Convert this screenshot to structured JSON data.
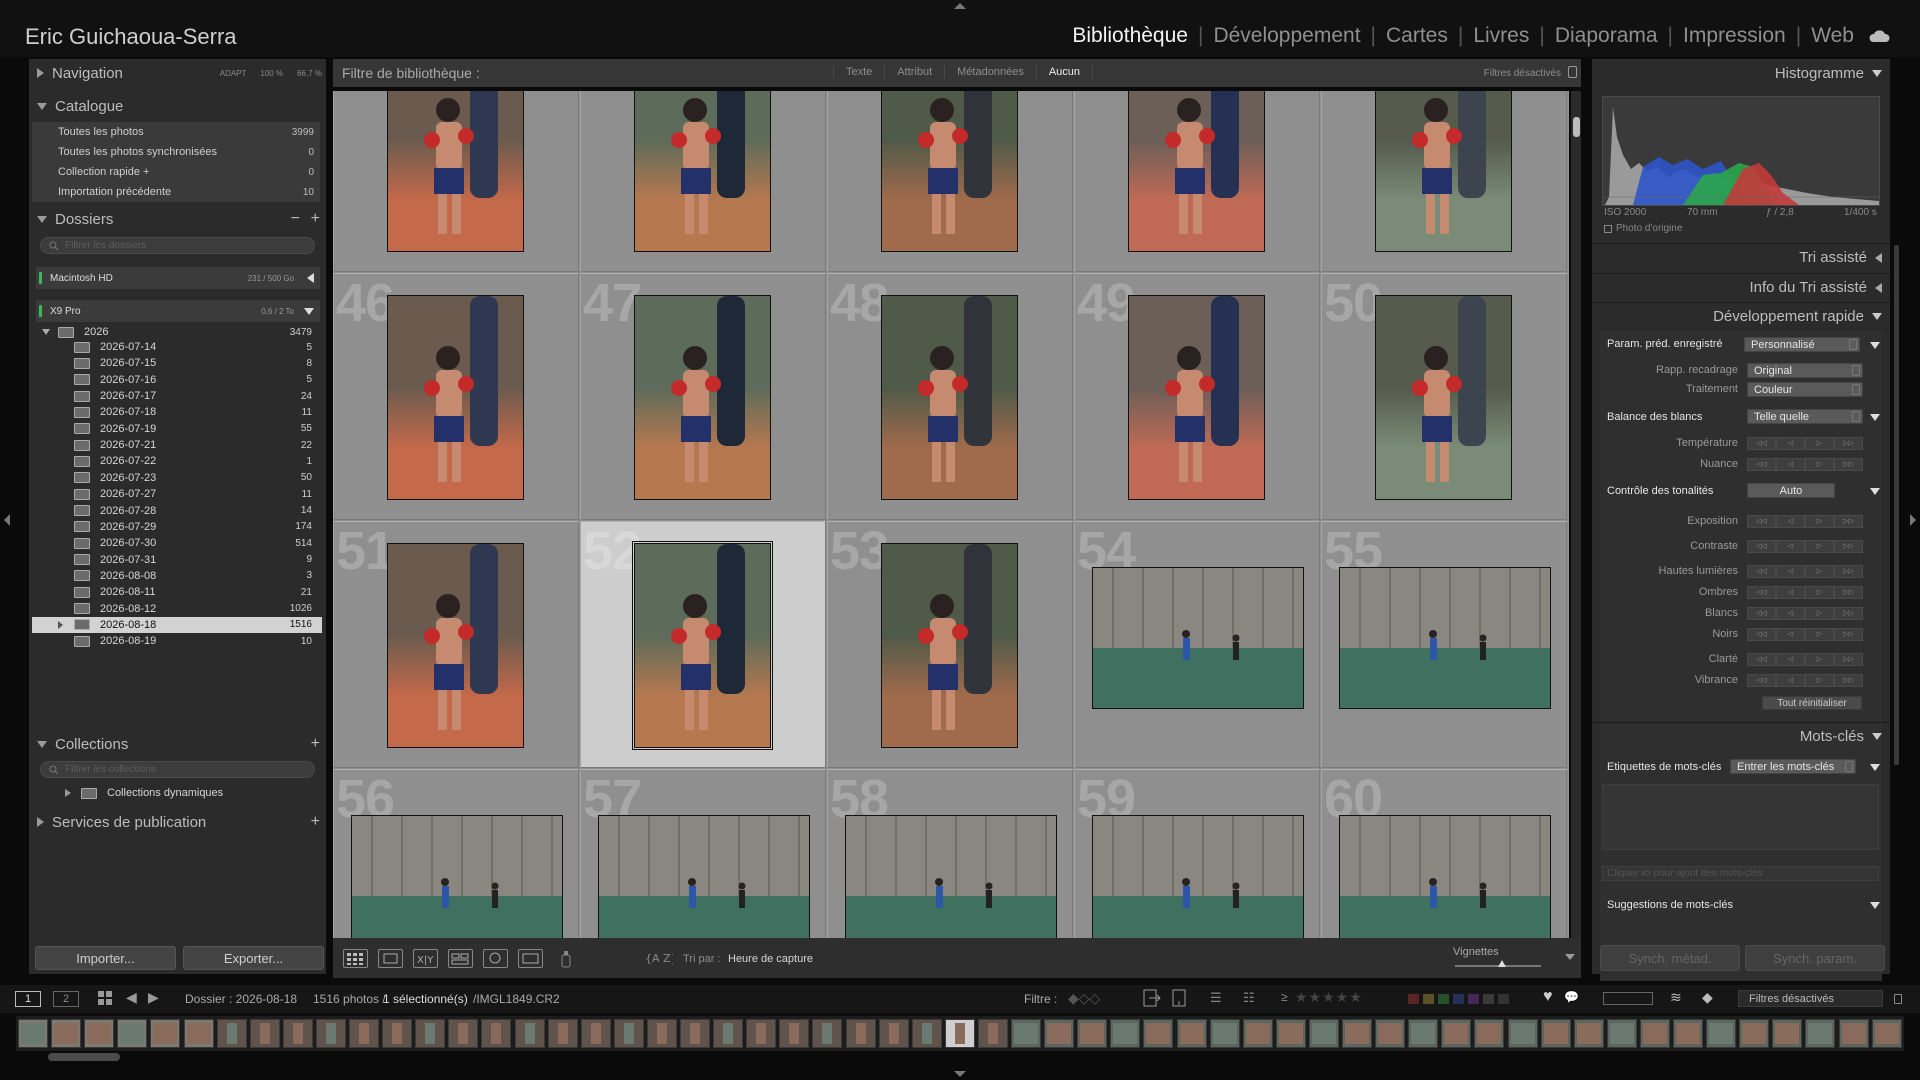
{
  "app": {
    "identity": "Eric Guichaoua-Serra",
    "modules": [
      "Bibliothèque",
      "Développement",
      "Cartes",
      "Livres",
      "Diaporama",
      "Impression",
      "Web"
    ],
    "active_module": "Bibliothèque"
  },
  "left_panel": {
    "navigation": {
      "title": "Navigation",
      "opts": [
        "ADAPT",
        "100 %",
        "66,7 %"
      ]
    },
    "catalogue": {
      "title": "Catalogue",
      "items": [
        {
          "label": "Toutes les photos",
          "count": "3999"
        },
        {
          "label": "Toutes les photos synchronisées",
          "count": "0"
        },
        {
          "label": "Collection rapide +",
          "count": "0"
        },
        {
          "label": "Importation précédente",
          "count": "10"
        }
      ]
    },
    "dossiers": {
      "title": "Dossiers",
      "search_placeholder": "Filtrer les dossiers",
      "volumes": [
        {
          "name": "Macintosh HD",
          "size": "231 / 500 Go"
        },
        {
          "name": "X9 Pro",
          "size": "0,6 / 2 To"
        }
      ],
      "root": {
        "name": "2026",
        "count": "3479"
      },
      "folders": [
        {
          "name": "2026-07-14",
          "count": "5"
        },
        {
          "name": "2026-07-15",
          "count": "8"
        },
        {
          "name": "2026-07-16",
          "count": "5"
        },
        {
          "name": "2026-07-17",
          "count": "24"
        },
        {
          "name": "2026-07-18",
          "count": "11"
        },
        {
          "name": "2026-07-19",
          "count": "55"
        },
        {
          "name": "2026-07-21",
          "count": "22"
        },
        {
          "name": "2026-07-22",
          "count": "1"
        },
        {
          "name": "2026-07-23",
          "count": "50"
        },
        {
          "name": "2026-07-27",
          "count": "11"
        },
        {
          "name": "2026-07-28",
          "count": "14"
        },
        {
          "name": "2026-07-29",
          "count": "174"
        },
        {
          "name": "2026-07-30",
          "count": "514"
        },
        {
          "name": "2026-07-31",
          "count": "9"
        },
        {
          "name": "2026-08-08",
          "count": "3"
        },
        {
          "name": "2026-08-11",
          "count": "21"
        },
        {
          "name": "2026-08-12",
          "count": "1026"
        },
        {
          "name": "2026-08-18",
          "count": "1516"
        },
        {
          "name": "2026-08-19",
          "count": "10"
        }
      ],
      "selected_folder": "2026-08-18"
    },
    "collections": {
      "title": "Collections",
      "search_placeholder": "Filtrer les collections",
      "items": [
        {
          "label": "Collections dynamiques"
        }
      ]
    },
    "publish": {
      "title": "Services de publication"
    },
    "import_label": "Importer...",
    "export_label": "Exporter..."
  },
  "filter_bar": {
    "title": "Filtre de bibliothèque :",
    "items": [
      "Texte",
      "Attribut",
      "Métadonnées",
      "Aucun"
    ],
    "active": "Aucun",
    "status": "Filtres désactivés"
  },
  "grid": {
    "cells": [
      {
        "num": "",
        "orient": "portrait"
      },
      {
        "num": "",
        "orient": "portrait"
      },
      {
        "num": "",
        "orient": "portrait"
      },
      {
        "num": "",
        "orient": "portrait"
      },
      {
        "num": "",
        "orient": "portrait"
      },
      {
        "num": "46",
        "orient": "portrait"
      },
      {
        "num": "47",
        "orient": "portrait"
      },
      {
        "num": "48",
        "orient": "portrait"
      },
      {
        "num": "49",
        "orient": "portrait"
      },
      {
        "num": "50",
        "orient": "portrait"
      },
      {
        "num": "51",
        "orient": "portrait"
      },
      {
        "num": "52",
        "orient": "portrait",
        "selected": true
      },
      {
        "num": "53",
        "orient": "portrait"
      },
      {
        "num": "54",
        "orient": "landscape"
      },
      {
        "num": "55",
        "orient": "landscape"
      },
      {
        "num": "56",
        "orient": "landscape"
      },
      {
        "num": "57",
        "orient": "landscape"
      },
      {
        "num": "58",
        "orient": "landscape"
      },
      {
        "num": "59",
        "orient": "landscape"
      },
      {
        "num": "60",
        "orient": "landscape"
      }
    ]
  },
  "toolbar": {
    "sort_label": "Tri par :",
    "sort_value": "Heure de capture",
    "thumbs_label": "Vignettes"
  },
  "right_panel": {
    "histogram": {
      "title": "Histogramme",
      "iso": "ISO 2000",
      "focal": "70 mm",
      "aperture": "ƒ / 2,8",
      "shutter": "1/400 s",
      "original_label": "Photo d'origine"
    },
    "tri_assiste": "Tri assisté",
    "info_tri": "Info du Tri assisté",
    "quick_develop": {
      "title": "Développement rapide",
      "preset_label": "Param. préd. enregistré",
      "preset_value": "Personnalisé",
      "crop_label": "Rapp. recadrage",
      "crop_value": "Original",
      "treatment_label": "Traitement",
      "treatment_value": "Couleur",
      "wb_label": "Balance des blancs",
      "wb_value": "Telle quelle",
      "temp_label": "Température",
      "tint_label": "Nuance",
      "tone_label": "Contrôle des tonalités",
      "auto_label": "Auto",
      "sliders": [
        "Exposition",
        "Contraste",
        "Hautes lumières",
        "Ombres",
        "Blancs",
        "Noirs",
        "Clarté",
        "Vibrance"
      ],
      "reset_label": "Tout réinitialiser"
    },
    "keywords": {
      "title": "Mots-clés",
      "tags_label": "Etiquettes de mots-clés",
      "tags_value": "Entrer les mots-clés",
      "add_placeholder": "Cliquer ici pour ajout des mots-clés",
      "suggest_label": "Suggestions de mots-clés"
    },
    "sync_meta": "Synch. métad.",
    "sync_param": "Synch. param."
  },
  "filmstrip": {
    "pages": [
      "1",
      "2"
    ],
    "folder": "Dossier : 2026-08-18",
    "count": "1516 photos /",
    "selected": "1 sélectionné(s)",
    "file": "/IMGL1849.CR2",
    "filter_label": "Filtre :",
    "filter_status": "Filtres désactivés"
  }
}
